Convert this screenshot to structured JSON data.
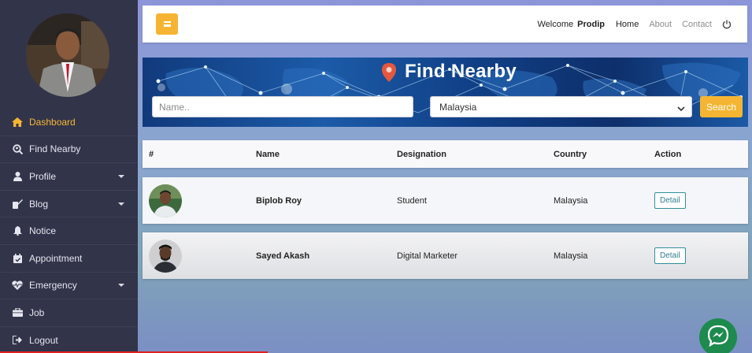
{
  "topbar": {
    "welcome_text": "Welcome",
    "username": "Prodip",
    "links": [
      "Home",
      "About",
      "Contact"
    ]
  },
  "sidebar": {
    "items": [
      {
        "label": "Dashboard",
        "icon": "home-icon",
        "active": true
      },
      {
        "label": "Find Nearby",
        "icon": "search-location-icon"
      },
      {
        "label": "Profile",
        "icon": "user-icon",
        "has_submenu": true
      },
      {
        "label": "Blog",
        "icon": "blog-icon",
        "has_submenu": true
      },
      {
        "label": "Notice",
        "icon": "bell-icon"
      },
      {
        "label": "Appointment",
        "icon": "calendar-check-icon"
      },
      {
        "label": "Emergency",
        "icon": "heartbeat-icon",
        "has_submenu": true
      },
      {
        "label": "Job",
        "icon": "briefcase-icon"
      },
      {
        "label": "Logout",
        "icon": "sign-out-icon"
      }
    ]
  },
  "banner": {
    "title": "Find Nearby",
    "name_placeholder": "Name..",
    "country_value": "Malaysia",
    "search_label": "Search"
  },
  "table": {
    "headers": [
      "#",
      "Name",
      "Designation",
      "Country",
      "Action"
    ],
    "rows": [
      {
        "name": "Biplob Roy",
        "designation": "Student",
        "country": "Malaysia",
        "action": "Detail"
      },
      {
        "name": "Sayed Akash",
        "designation": "Digital Marketer",
        "country": "Malaysia",
        "action": "Detail"
      }
    ]
  },
  "colors": {
    "sidebar_bg": "#32344a",
    "accent": "#f5b532",
    "active_item": "#f5b733",
    "detail_border": "#2f8f9b",
    "messenger": "#1d8a4e"
  }
}
